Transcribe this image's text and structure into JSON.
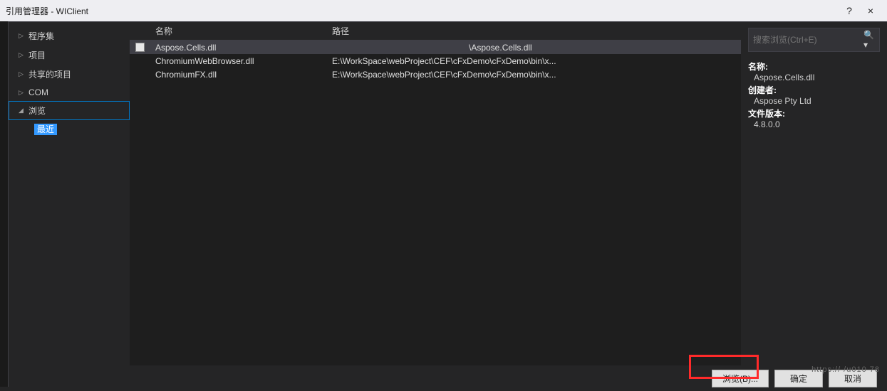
{
  "window": {
    "title": "引用管理器 - WIClient",
    "help": "?",
    "close": "×"
  },
  "sidebar": {
    "items": [
      {
        "label": "程序集",
        "expanded": false
      },
      {
        "label": "项目",
        "expanded": false
      },
      {
        "label": "共享的项目",
        "expanded": false
      },
      {
        "label": "COM",
        "expanded": false
      },
      {
        "label": "浏览",
        "expanded": true,
        "selected": true
      }
    ],
    "sub": "最近"
  },
  "columns": {
    "name": "名称",
    "path": "路径"
  },
  "rows": [
    {
      "name": "Aspose.Cells.dll",
      "path": "\\Aspose.Cells.dll",
      "selected": true
    },
    {
      "name": "ChromiumWebBrowser.dll",
      "path": "E:\\WorkSpace\\webProject\\CEF\\cFxDemo\\cFxDemo\\bin\\x..."
    },
    {
      "name": "ChromiumFX.dll",
      "path": "E:\\WorkSpace\\webProject\\CEF\\cFxDemo\\cFxDemo\\bin\\x..."
    }
  ],
  "search": {
    "placeholder": "搜索浏览(Ctrl+E)"
  },
  "details": {
    "name_lbl": "名称:",
    "name_val": "Aspose.Cells.dll",
    "creator_lbl": "创建者:",
    "creator_val": "Aspose Pty Ltd",
    "version_lbl": "文件版本:",
    "version_val": "4.8.0.0"
  },
  "footer": {
    "browse": "浏览(B)...",
    "ok": "确定",
    "cancel": "取消"
  }
}
